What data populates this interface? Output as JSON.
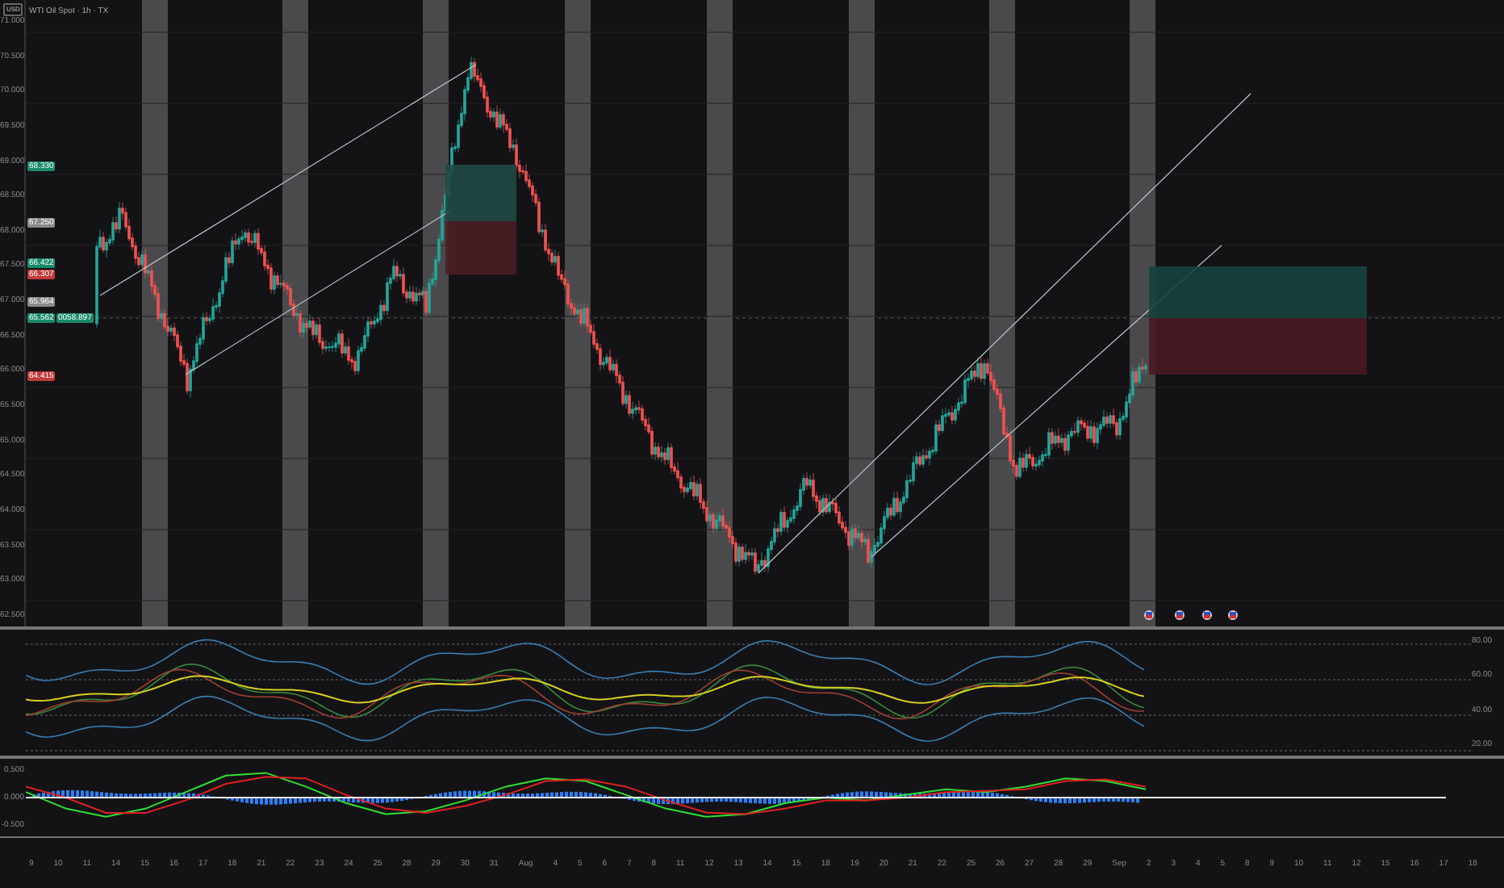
{
  "header": {
    "currency": "USD",
    "title": "WTI Oil Spot · 1h · TX"
  },
  "price_axis": {
    "labels": [
      "71.000",
      "70.500",
      "70.000",
      "69.500",
      "69.000",
      "68.500",
      "68.000",
      "67.500",
      "67.000",
      "66.500",
      "66.000",
      "65.500",
      "65.000",
      "64.500",
      "64.000",
      "63.500",
      "63.000",
      "62.500"
    ]
  },
  "price_badges": [
    {
      "text": "68.330",
      "color": "#1b8a6b"
    },
    {
      "text": "67.250",
      "color": "#8a8a8a"
    },
    {
      "text": "66.422",
      "color": "#1b8a6b"
    },
    {
      "text": "66.307",
      "color": "#c23a3a"
    },
    {
      "text": "65.964",
      "color": "#8a8a8a"
    },
    {
      "text": "65.562",
      "color": "#1b8a6b"
    },
    {
      "text": "64.415",
      "color": "#c23a3a"
    }
  ],
  "price_tag": {
    "text": "0058.897"
  },
  "rsi_panel": {
    "levels": [
      "80.00",
      "60.00",
      "40.00",
      "20.00"
    ]
  },
  "macd_panel": {
    "chart_data": {
      "type": "line",
      "ylim": [
        -0.5,
        0.5
      ],
      "yticks": [
        {
          "value": 0.5,
          "label": "0.500"
        },
        {
          "value": 0,
          "label": "0.000"
        },
        {
          "value": -0.5,
          "label": "-0.500"
        }
      ],
      "series": [
        {
          "color": "#30e030",
          "values": [
            0.1,
            -0.2,
            -0.35,
            -0.2,
            0.1,
            0.4,
            0.45,
            0.2,
            -0.1,
            -0.3,
            -0.25,
            -0.05,
            0.2,
            0.35,
            0.3,
            0.05,
            -0.2,
            -0.35,
            -0.3,
            -0.1,
            0.0,
            -0.05,
            0.05,
            0.15,
            0.1,
            0.2,
            0.35,
            0.3,
            0.15
          ]
        },
        {
          "color": "#e02020",
          "values": [
            0.2,
            0.0,
            -0.28,
            -0.28,
            -0.05,
            0.25,
            0.38,
            0.35,
            0.05,
            -0.2,
            -0.28,
            -0.15,
            0.05,
            0.3,
            0.33,
            0.2,
            -0.05,
            -0.27,
            -0.3,
            -0.2,
            -0.05,
            -0.05,
            0.0,
            0.1,
            0.12,
            0.15,
            0.3,
            0.33,
            0.2
          ]
        }
      ]
    }
  },
  "time_axis": {
    "labels": [
      "9",
      "10",
      "11",
      "14",
      "15",
      "16",
      "17",
      "18",
      "21",
      "22",
      "23",
      "24",
      "25",
      "28",
      "29",
      "30",
      "31",
      "Aug",
      "4",
      "5",
      "6",
      "7",
      "8",
      "11",
      "12",
      "13",
      "14",
      "15",
      "18",
      "19",
      "20",
      "21",
      "22",
      "25",
      "26",
      "27",
      "28",
      "29",
      "Sep",
      "2",
      "3",
      "4",
      "5",
      "8",
      "9",
      "10",
      "11",
      "12",
      "15",
      "16",
      "17",
      "18"
    ]
  }
}
